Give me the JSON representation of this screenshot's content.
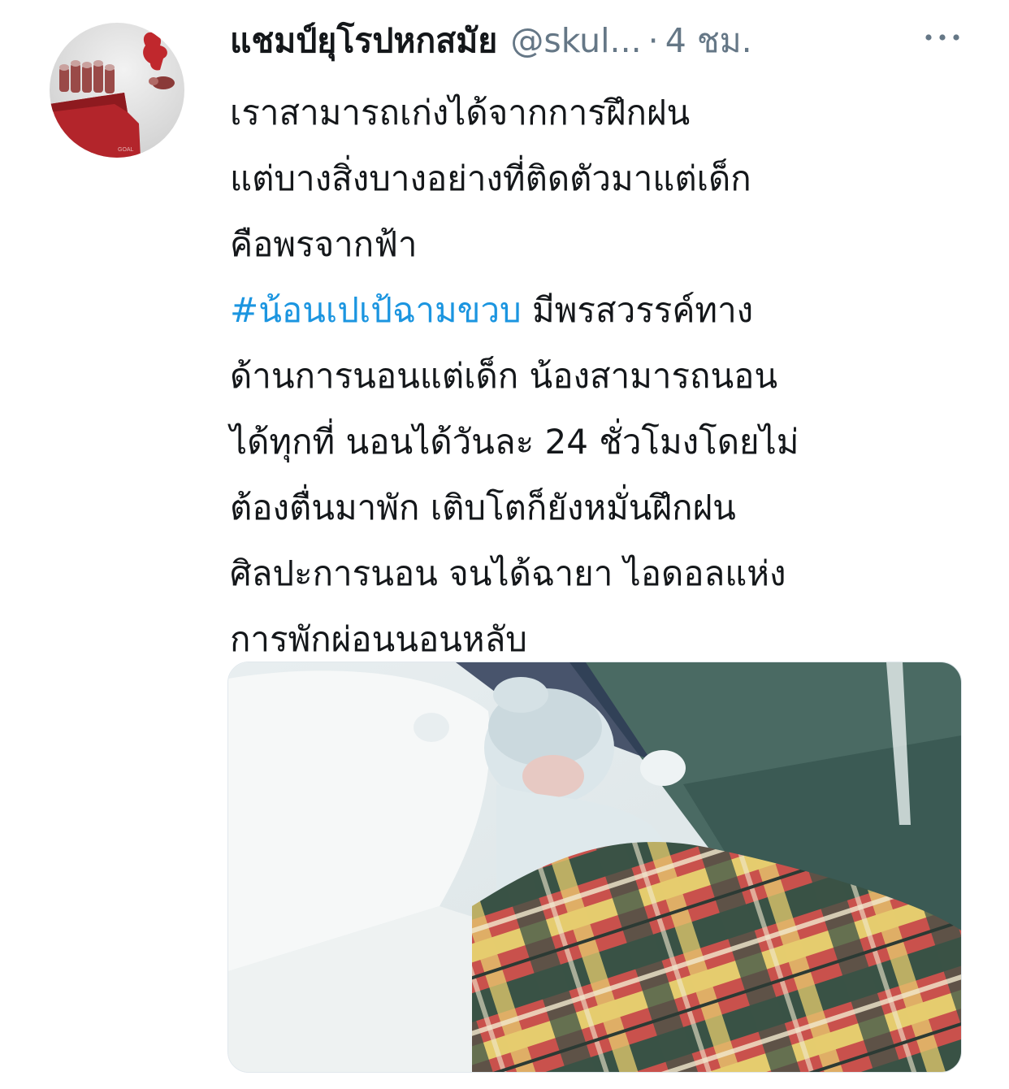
{
  "tweet": {
    "display_name": "แชมป์ยุโรปหกสมัย",
    "handle": "@skul...",
    "separator": "·",
    "time": "4 ชม.",
    "text_intro": "เราสามารถเก่งได้จากการฝึกฝน\nแต่บางสิ่งบางอย่างที่ติดตัวมาแต่เด็ก\nคือพรจากฟ้า\n",
    "hashtag": "#น้อนเปเป้ฉามขวบ",
    "text_rest": " มีพรสวรรค์ทาง\nด้านการนอนแต่เด็ก น้องสามารถนอน\nได้ทุกที่ นอนได้วันละ 24 ชั่วโมงโดยไม่\nต้องตื่นมาพัก เติบโตก็ยังหมั่นฝึกฝน\nศิลปะการนอน จนได้ฉายา ไอดอลแห่ง\nการพักผ่อนนอนหลับ",
    "more_icon": "more-horizontal-icon",
    "avatar_logo_text": "GOAL"
  },
  "colors": {
    "text": "#14171a",
    "secondary": "#657786",
    "hashtag": "#1b95e0",
    "avatar_red": "#c0282d"
  }
}
